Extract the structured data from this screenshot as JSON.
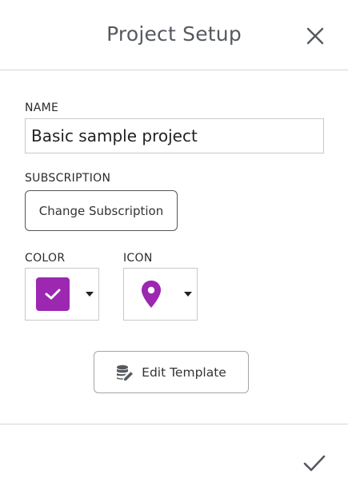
{
  "dialog": {
    "title": "Project Setup",
    "close_icon": "close-icon",
    "confirm_icon": "checkmark-icon"
  },
  "name": {
    "label": "NAME",
    "value": "Basic sample project"
  },
  "subscription": {
    "label": "SUBSCRIPTION",
    "button_label": "Change Subscription"
  },
  "color": {
    "label": "COLOR",
    "selected_color": "#9c27b0",
    "swatch_icon": "check-icon"
  },
  "icon": {
    "label": "ICON",
    "selected_icon": "map-pin-icon",
    "icon_color": "#9c27b0"
  },
  "template": {
    "button_label": "Edit Template",
    "button_icon": "database-edit-icon"
  }
}
